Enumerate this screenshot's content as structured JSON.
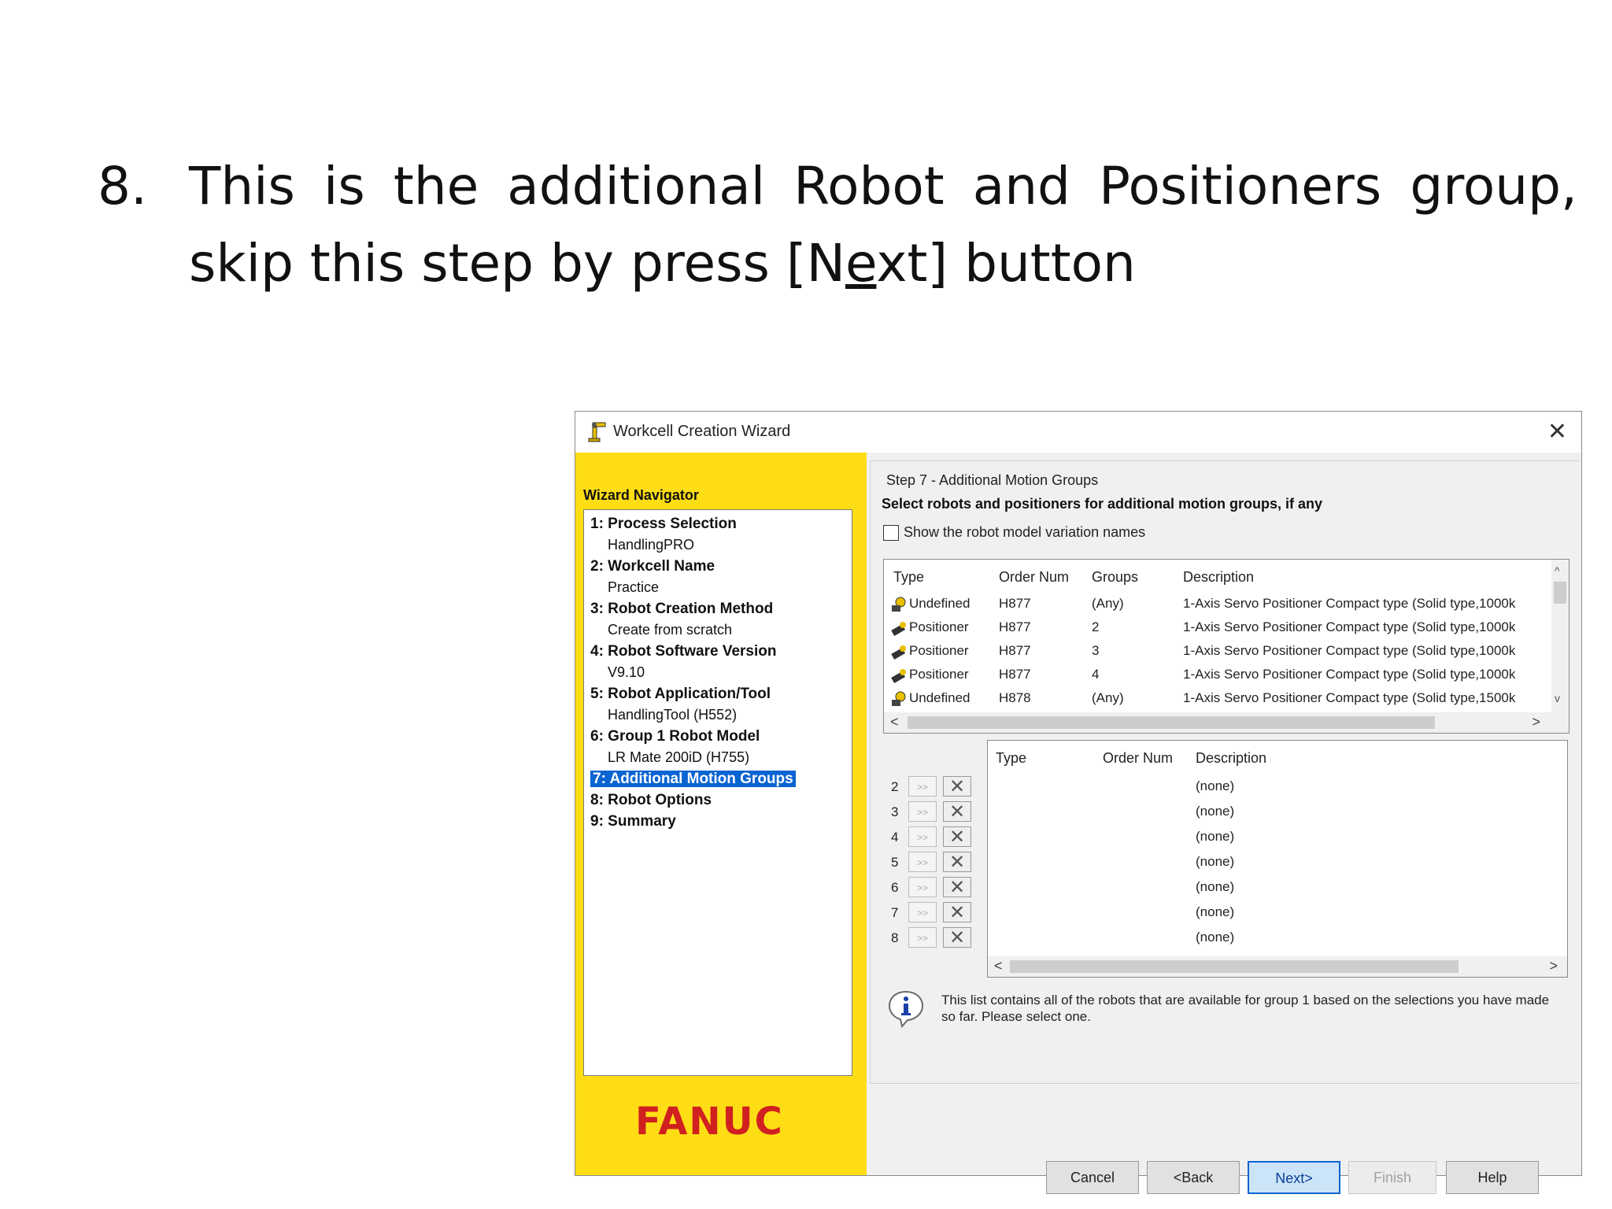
{
  "slide": {
    "number": "8.",
    "line1": "This is the additional Robot and Positioners group,",
    "line2_prefix": "skip this step by press [N",
    "line2_underlined": "e",
    "line2_suffix": "xt] button"
  },
  "window": {
    "title": "Workcell Creation Wizard",
    "close_glyph": "✕"
  },
  "navigator": {
    "title": "Wizard Navigator",
    "steps": [
      {
        "label": "1: Process Selection",
        "value": "HandlingPRO"
      },
      {
        "label": "2: Workcell Name",
        "value": "Practice"
      },
      {
        "label": "3: Robot Creation Method",
        "value": "Create from scratch"
      },
      {
        "label": "4: Robot Software Version",
        "value": "V9.10"
      },
      {
        "label": "5: Robot Application/Tool",
        "value": "HandlingTool (H552)"
      },
      {
        "label": "6: Group 1 Robot Model",
        "value": "LR Mate 200iD (H755)"
      },
      {
        "label": "7: Additional Motion Groups",
        "value": ""
      },
      {
        "label": "8: Robot Options",
        "value": ""
      },
      {
        "label": "9: Summary",
        "value": ""
      }
    ],
    "brand": "FANUC"
  },
  "step": {
    "title": "Step 7 - Additional Motion Groups",
    "subtitle": "Select robots and positioners for additional motion groups, if any",
    "checkbox_label": "Show the robot model variation names"
  },
  "available": {
    "headers": {
      "type": "Type",
      "order": "Order Num",
      "groups": "Groups",
      "description": "Description"
    },
    "rows": [
      {
        "type": "Undefined",
        "order": "H877",
        "groups": "(Any)",
        "description": "1-Axis Servo Positioner Compact type (Solid type,1000k"
      },
      {
        "type": "Positioner",
        "order": "H877",
        "groups": "2",
        "description": "1-Axis Servo Positioner Compact type (Solid type,1000k"
      },
      {
        "type": "Positioner",
        "order": "H877",
        "groups": "3",
        "description": "1-Axis Servo Positioner Compact type (Solid type,1000k"
      },
      {
        "type": "Positioner",
        "order": "H877",
        "groups": "4",
        "description": "1-Axis Servo Positioner Compact type (Solid type,1000k"
      },
      {
        "type": "Undefined",
        "order": "H878",
        "groups": "(Any)",
        "description": "1-Axis Servo Positioner Compact type (Solid type,1500k"
      }
    ],
    "scroll_left": "<",
    "scroll_right": ">",
    "scroll_up": "^",
    "scroll_down": "v"
  },
  "selected": {
    "headers": {
      "type": "Type",
      "order": "Order Num",
      "description": "Description"
    },
    "groups": [
      {
        "num": "2",
        "desc": "(none)"
      },
      {
        "num": "3",
        "desc": "(none)"
      },
      {
        "num": "4",
        "desc": "(none)"
      },
      {
        "num": "5",
        "desc": "(none)"
      },
      {
        "num": "6",
        "desc": "(none)"
      },
      {
        "num": "7",
        "desc": "(none)"
      },
      {
        "num": "8",
        "desc": "(none)"
      }
    ],
    "add_glyph": ">>",
    "remove_glyph": "✕",
    "scroll_left": "<",
    "scroll_right": ">"
  },
  "info": {
    "text": "This list contains all of the robots that are available for group 1 based on the selections you have made so far.  Please select one."
  },
  "buttons": {
    "cancel": "Cancel",
    "back": "<Back",
    "next": "Next>",
    "finish": "Finish",
    "help": "Help"
  }
}
